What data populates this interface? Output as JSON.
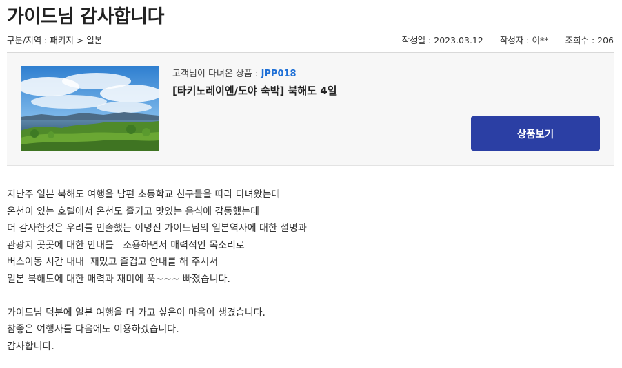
{
  "post": {
    "title": "가이드님 감사합니다",
    "category": "구분/지역 : 패키지 > 일본",
    "date": "작성일 : 2023.03.12",
    "author": "작성자 : 이**",
    "views": "조회수 : 206"
  },
  "product": {
    "code_label": "고객님이 다녀온 상품 : ",
    "code": "JPP018",
    "name": "[타키노레이엔/도야 숙박] 북해도 4일",
    "view_button": "상품보기"
  },
  "body": {
    "paragraph1": [
      "지난주 일본 북해도 여행을 남편 초등학교 친구들을 따라 다녀왔는데",
      "온천이 있는 호텔에서 온천도 즐기고 맛있는 음식에 감동했는데",
      "더 감사한것은 우리를 인솔했는 이명진 가이드님의 일본역사에 대한 설명과",
      "관광지 곳곳에 대한 안내를   조용하면서 매력적인 목소리로",
      "버스이동 시간 내내  재밌고 즐겁고 안내를 해 주셔서",
      "일본 북해도에 대한 매력과 재미에 푹~~~ 빠졌습니다."
    ],
    "paragraph2": [
      "가이드님 덕분에 일본 여행을 더 가고 싶은이 마음이 생겼습니다.",
      "참좋은 여행사를 다음에도 이용하겠습니다.",
      "감사합니다."
    ]
  }
}
